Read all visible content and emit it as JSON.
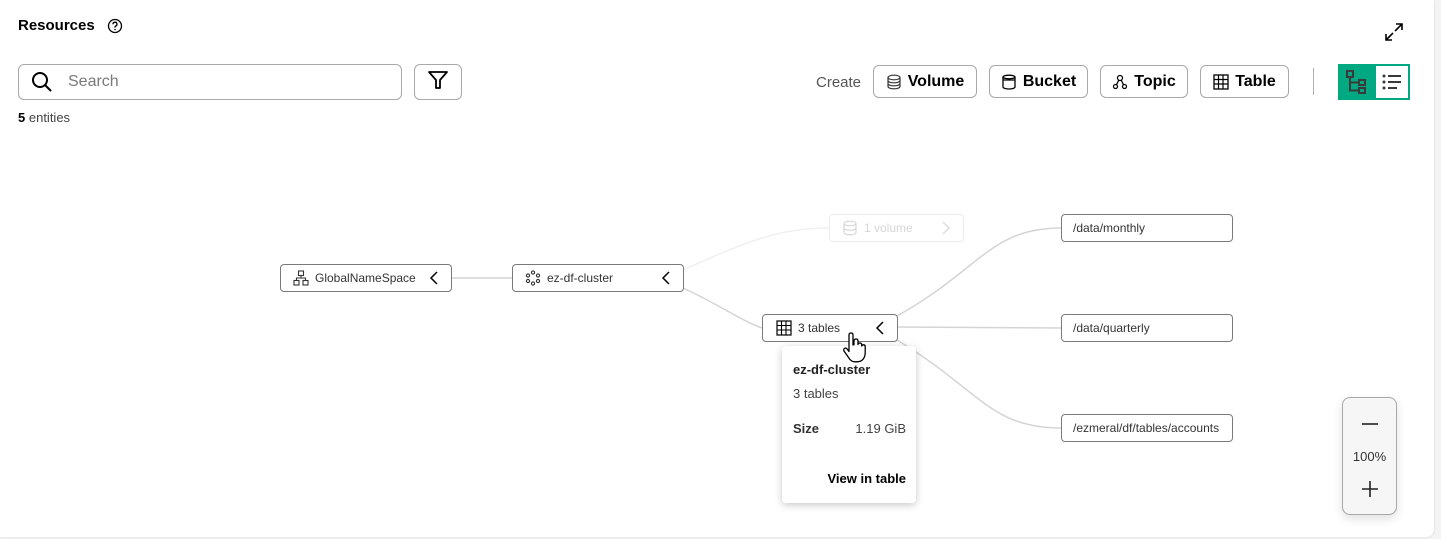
{
  "header": {
    "title": "Resources",
    "help_icon": "help-circle-icon",
    "expand_icon": "expand-icon"
  },
  "search": {
    "placeholder": "Search",
    "value": "",
    "icon": "search-icon"
  },
  "filter": {
    "icon": "filter-icon"
  },
  "entities": {
    "count": "5",
    "label": "entities"
  },
  "create": {
    "label": "Create",
    "buttons": [
      {
        "label": "Volume",
        "icon": "database-icon"
      },
      {
        "label": "Bucket",
        "icon": "bucket-icon"
      },
      {
        "label": "Topic",
        "icon": "topic-icon"
      },
      {
        "label": "Table",
        "icon": "table-icon"
      }
    ]
  },
  "view_toggle": {
    "options": [
      {
        "name": "tree",
        "icon": "tree-view-icon",
        "active": true
      },
      {
        "name": "list",
        "icon": "list-view-icon",
        "active": false
      }
    ],
    "accent": "#01a982"
  },
  "graph": {
    "nodes": [
      {
        "id": "gns",
        "label": "GlobalNameSpace",
        "icon": "hierarchy-icon",
        "expanded": true
      },
      {
        "id": "cluster",
        "label": "ez-df-cluster",
        "icon": "cluster-icon",
        "expanded": true
      },
      {
        "id": "volume",
        "label": "1 volume",
        "icon": "database-icon",
        "expanded": false,
        "faded": true
      },
      {
        "id": "tables",
        "label": "3 tables",
        "icon": "table-icon",
        "expanded": true
      },
      {
        "id": "t1",
        "label": "/data/monthly"
      },
      {
        "id": "t2",
        "label": "/data/quarterly"
      },
      {
        "id": "t3",
        "label": "/ezmeral/df/tables/accounts"
      }
    ],
    "edges": [
      [
        "gns",
        "cluster"
      ],
      [
        "cluster",
        "volume"
      ],
      [
        "cluster",
        "tables"
      ],
      [
        "tables",
        "t1"
      ],
      [
        "tables",
        "t2"
      ],
      [
        "tables",
        "t3"
      ]
    ]
  },
  "tooltip": {
    "title": "ez-df-cluster",
    "subtitle": "3 tables",
    "size_label": "Size",
    "size_value": "1.19 GiB",
    "link": "View in table"
  },
  "zoom": {
    "level": "100%",
    "minus_icon": "minus-icon",
    "plus_icon": "plus-icon"
  }
}
